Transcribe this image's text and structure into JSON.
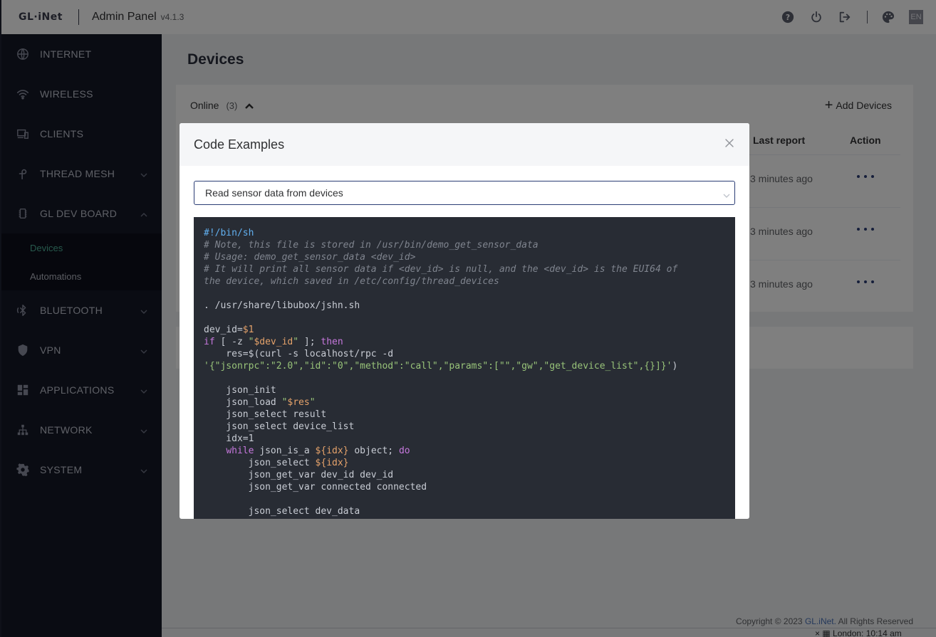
{
  "header": {
    "logo": "GL·iNet",
    "title": "Admin Panel",
    "version": "v4.1.3",
    "lang": "EN",
    "icons": [
      "help-icon",
      "power-icon",
      "logout-icon",
      "palette-icon"
    ]
  },
  "sidebar": {
    "items": [
      {
        "label": "INTERNET",
        "icon": "globe-icon"
      },
      {
        "label": "WIRELESS",
        "icon": "wifi-icon"
      },
      {
        "label": "CLIENTS",
        "icon": "clients-icon"
      },
      {
        "label": "THREAD MESH",
        "icon": "thread-icon"
      },
      {
        "label": "GL DEV BOARD",
        "icon": "chip-icon"
      },
      {
        "label": "BLUETOOTH",
        "icon": "bluetooth-icon"
      },
      {
        "label": "VPN",
        "icon": "shield-icon"
      },
      {
        "label": "APPLICATIONS",
        "icon": "apps-icon"
      },
      {
        "label": "NETWORK",
        "icon": "network-icon"
      },
      {
        "label": "SYSTEM",
        "icon": "gear-icon"
      }
    ],
    "submenu": [
      {
        "label": "Devices",
        "active": true
      },
      {
        "label": "Automations",
        "active": false
      }
    ]
  },
  "main": {
    "page_title": "Devices",
    "online_label": "Online",
    "online_count": "(3)",
    "add_devices": "Add Devices",
    "columns": {
      "last_report": "Last report",
      "action": "Action"
    },
    "rows": [
      {
        "last_report": "3 minutes ago"
      },
      {
        "last_report": "3 minutes ago"
      },
      {
        "last_report": "3 minutes ago"
      }
    ]
  },
  "footer": {
    "copyright_prefix": "Copyright © 2023",
    "brand": "GL.iNet.",
    "copyright_suffix": "All Rights Reserved",
    "clock": "London: 10:14 am"
  },
  "modal": {
    "title": "Code Examples",
    "select_value": "Read sensor data from devices",
    "code_lines": [
      [
        {
          "t": "#!/bin/sh",
          "c": "shebang"
        }
      ],
      [
        {
          "t": "# Note, this file is stored in /usr/bin/demo_get_sensor_data",
          "c": "comment"
        }
      ],
      [
        {
          "t": "# Usage: demo_get_sensor_data <dev_id>",
          "c": "comment"
        }
      ],
      [
        {
          "t": "# It will print all sensor data if <dev_id> is null, and the <dev_id> is the EUI64 of",
          "c": "comment"
        }
      ],
      [
        {
          "t": "the device, which saved in /etc/config/thread_devices",
          "c": "comment"
        }
      ],
      [
        {
          "t": "",
          "c": ""
        }
      ],
      [
        {
          "t": ". /usr/share/libubox/jshn.sh",
          "c": ""
        }
      ],
      [
        {
          "t": "",
          "c": ""
        }
      ],
      [
        {
          "t": "dev_id=",
          "c": ""
        },
        {
          "t": "$1",
          "c": "var"
        }
      ],
      [
        {
          "t": "if",
          "c": "kw"
        },
        {
          "t": " [ -z ",
          "c": ""
        },
        {
          "t": "\"",
          "c": "str"
        },
        {
          "t": "$dev_id",
          "c": "var"
        },
        {
          "t": "\"",
          "c": "str"
        },
        {
          "t": " ]; ",
          "c": ""
        },
        {
          "t": "then",
          "c": "kw"
        }
      ],
      [
        {
          "t": "    res=$(curl -s localhost/rpc -d",
          "c": ""
        }
      ],
      [
        {
          "t": "'{\"jsonrpc\":\"2.0\",\"id\":\"0\",\"method\":\"call\",\"params\":[\"\",\"gw\",\"get_device_list\",{}]}'",
          "c": "str"
        },
        {
          "t": ")",
          "c": ""
        }
      ],
      [
        {
          "t": "",
          "c": ""
        }
      ],
      [
        {
          "t": "    json_init",
          "c": ""
        }
      ],
      [
        {
          "t": "    json_load ",
          "c": ""
        },
        {
          "t": "\"",
          "c": "str"
        },
        {
          "t": "$res",
          "c": "var"
        },
        {
          "t": "\"",
          "c": "str"
        }
      ],
      [
        {
          "t": "    json_select result",
          "c": ""
        }
      ],
      [
        {
          "t": "    json_select device_list",
          "c": ""
        }
      ],
      [
        {
          "t": "    idx=1",
          "c": ""
        }
      ],
      [
        {
          "t": "    ",
          "c": ""
        },
        {
          "t": "while",
          "c": "kw"
        },
        {
          "t": " json_is_a ",
          "c": ""
        },
        {
          "t": "${idx}",
          "c": "var"
        },
        {
          "t": " object; ",
          "c": ""
        },
        {
          "t": "do",
          "c": "kw"
        }
      ],
      [
        {
          "t": "        json_select ",
          "c": ""
        },
        {
          "t": "${idx}",
          "c": "var"
        }
      ],
      [
        {
          "t": "        json_get_var dev_id dev_id",
          "c": ""
        }
      ],
      [
        {
          "t": "        json_get_var connected connected",
          "c": ""
        }
      ],
      [
        {
          "t": "",
          "c": ""
        }
      ],
      [
        {
          "t": "        json_select dev_data",
          "c": ""
        }
      ]
    ]
  }
}
